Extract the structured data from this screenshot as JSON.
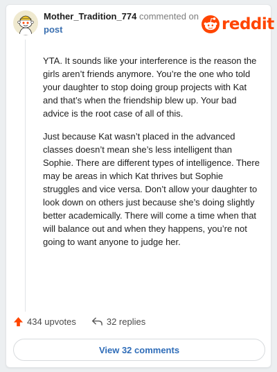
{
  "comment": {
    "author": "Mother_Tradition_774",
    "action_text": "commented on",
    "post_link": "post",
    "brand": "reddit",
    "paragraphs": [
      "YTA. It sounds like your interference is the reason the girls aren’t friends anymore. You’re the one who told your daughter to stop doing group projects with Kat and that’s when the friendship blew up. Your bad advice is the root case of all of this.",
      "Just because Kat wasn’t placed in the advanced classes doesn’t mean she’s less intelligent than Sophie. There are different types of intelligence. There may be areas in which Kat thrives but Sophie struggles and vice versa. Don’t allow your daughter to look down on others just because she’s doing slightly better academically. There will come a time when that will balance out and when they happens, you’re not going to want anyone to judge her."
    ],
    "upvotes_label": "434 upvotes",
    "replies_label": "32 replies",
    "view_comments_label": "View 32 comments"
  },
  "icons": {
    "logo": "reddit-snoo-icon",
    "upvote": "upvote-arrow-icon",
    "reply": "reply-arrow-icon"
  },
  "colors": {
    "brand": "#ff4500",
    "link": "#2e6cb8",
    "muted": "#7c7c7c"
  }
}
